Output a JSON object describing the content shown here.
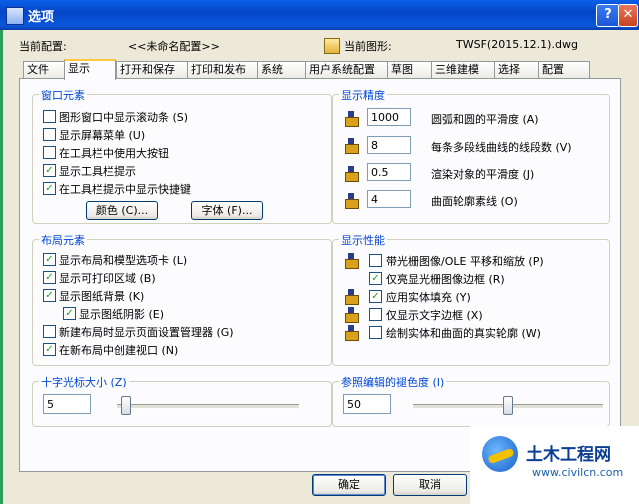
{
  "window": {
    "title": "选项"
  },
  "config": {
    "current_config_label": "当前配置:",
    "current_config_value": "<<未命名配置>>",
    "current_drawing_label": "当前图形:",
    "current_drawing_value": "TWSF(2015.12.1).dwg"
  },
  "tabs": [
    "文件",
    "显示",
    "打开和保存",
    "打印和发布",
    "系统",
    "用户系统配置",
    "草图",
    "三维建模",
    "选择",
    "配置"
  ],
  "active_tab": "显示",
  "window_elements": {
    "title": "窗口元素",
    "options": [
      {
        "label": "图形窗口中显示滚动条 (S)",
        "checked": false
      },
      {
        "label": "显示屏幕菜单 (U)",
        "checked": false
      },
      {
        "label": "在工具栏中使用大按钮",
        "checked": false
      },
      {
        "label": "显示工具栏提示",
        "checked": true
      },
      {
        "label": "在工具栏提示中显示快捷键",
        "checked": true
      }
    ],
    "colors_button": "颜色 (C)...",
    "fonts_button": "字体 (F)..."
  },
  "display_precision": {
    "title": "显示精度",
    "items": [
      {
        "value": "1000",
        "label": "圆弧和圆的平滑度 (A)"
      },
      {
        "value": "8",
        "label": "每条多段线曲线的线段数 (V)"
      },
      {
        "value": "0.5",
        "label": "渲染对象的平滑度 (J)"
      },
      {
        "value": "4",
        "label": "曲面轮廓素线 (O)"
      }
    ]
  },
  "layout_elements": {
    "title": "布局元素",
    "options": [
      {
        "label": "显示布局和模型选项卡 (L)",
        "checked": true
      },
      {
        "label": "显示可打印区域 (B)",
        "checked": true
      },
      {
        "label": "显示图纸背景 (K)",
        "checked": true
      },
      {
        "label": "显示图纸阴影 (E)",
        "checked": true
      },
      {
        "label": "新建布局时显示页面设置管理器 (G)",
        "checked": false
      },
      {
        "label": "在新布局中创建视口 (N)",
        "checked": true
      }
    ]
  },
  "display_performance": {
    "title": "显示性能",
    "options": [
      {
        "label": "带光栅图像/OLE 平移和缩放 (P)",
        "checked": false
      },
      {
        "label": "仅亮显光栅图像边框 (R)",
        "checked": true
      },
      {
        "label": "应用实体填充 (Y)",
        "checked": true
      },
      {
        "label": "仅显示文字边框 (X)",
        "checked": false
      },
      {
        "label": "绘制实体和曲面的真实轮廓 (W)",
        "checked": false
      }
    ]
  },
  "crosshair": {
    "title": "十字光标大小 (Z)",
    "value": "5",
    "level": 0.05
  },
  "xref_fade": {
    "title": "参照编辑的褪色度 (I)",
    "value": "50",
    "level": 0.5
  },
  "buttons": {
    "ok": "确定",
    "cancel": "取消"
  },
  "watermark": {
    "title": "土木工程网",
    "url": "www.civilcn.com"
  },
  "colors": {
    "title_bar": "#0A5FE8",
    "group_title": "#0046D5",
    "dialog_bg": "#ECE9D8"
  }
}
